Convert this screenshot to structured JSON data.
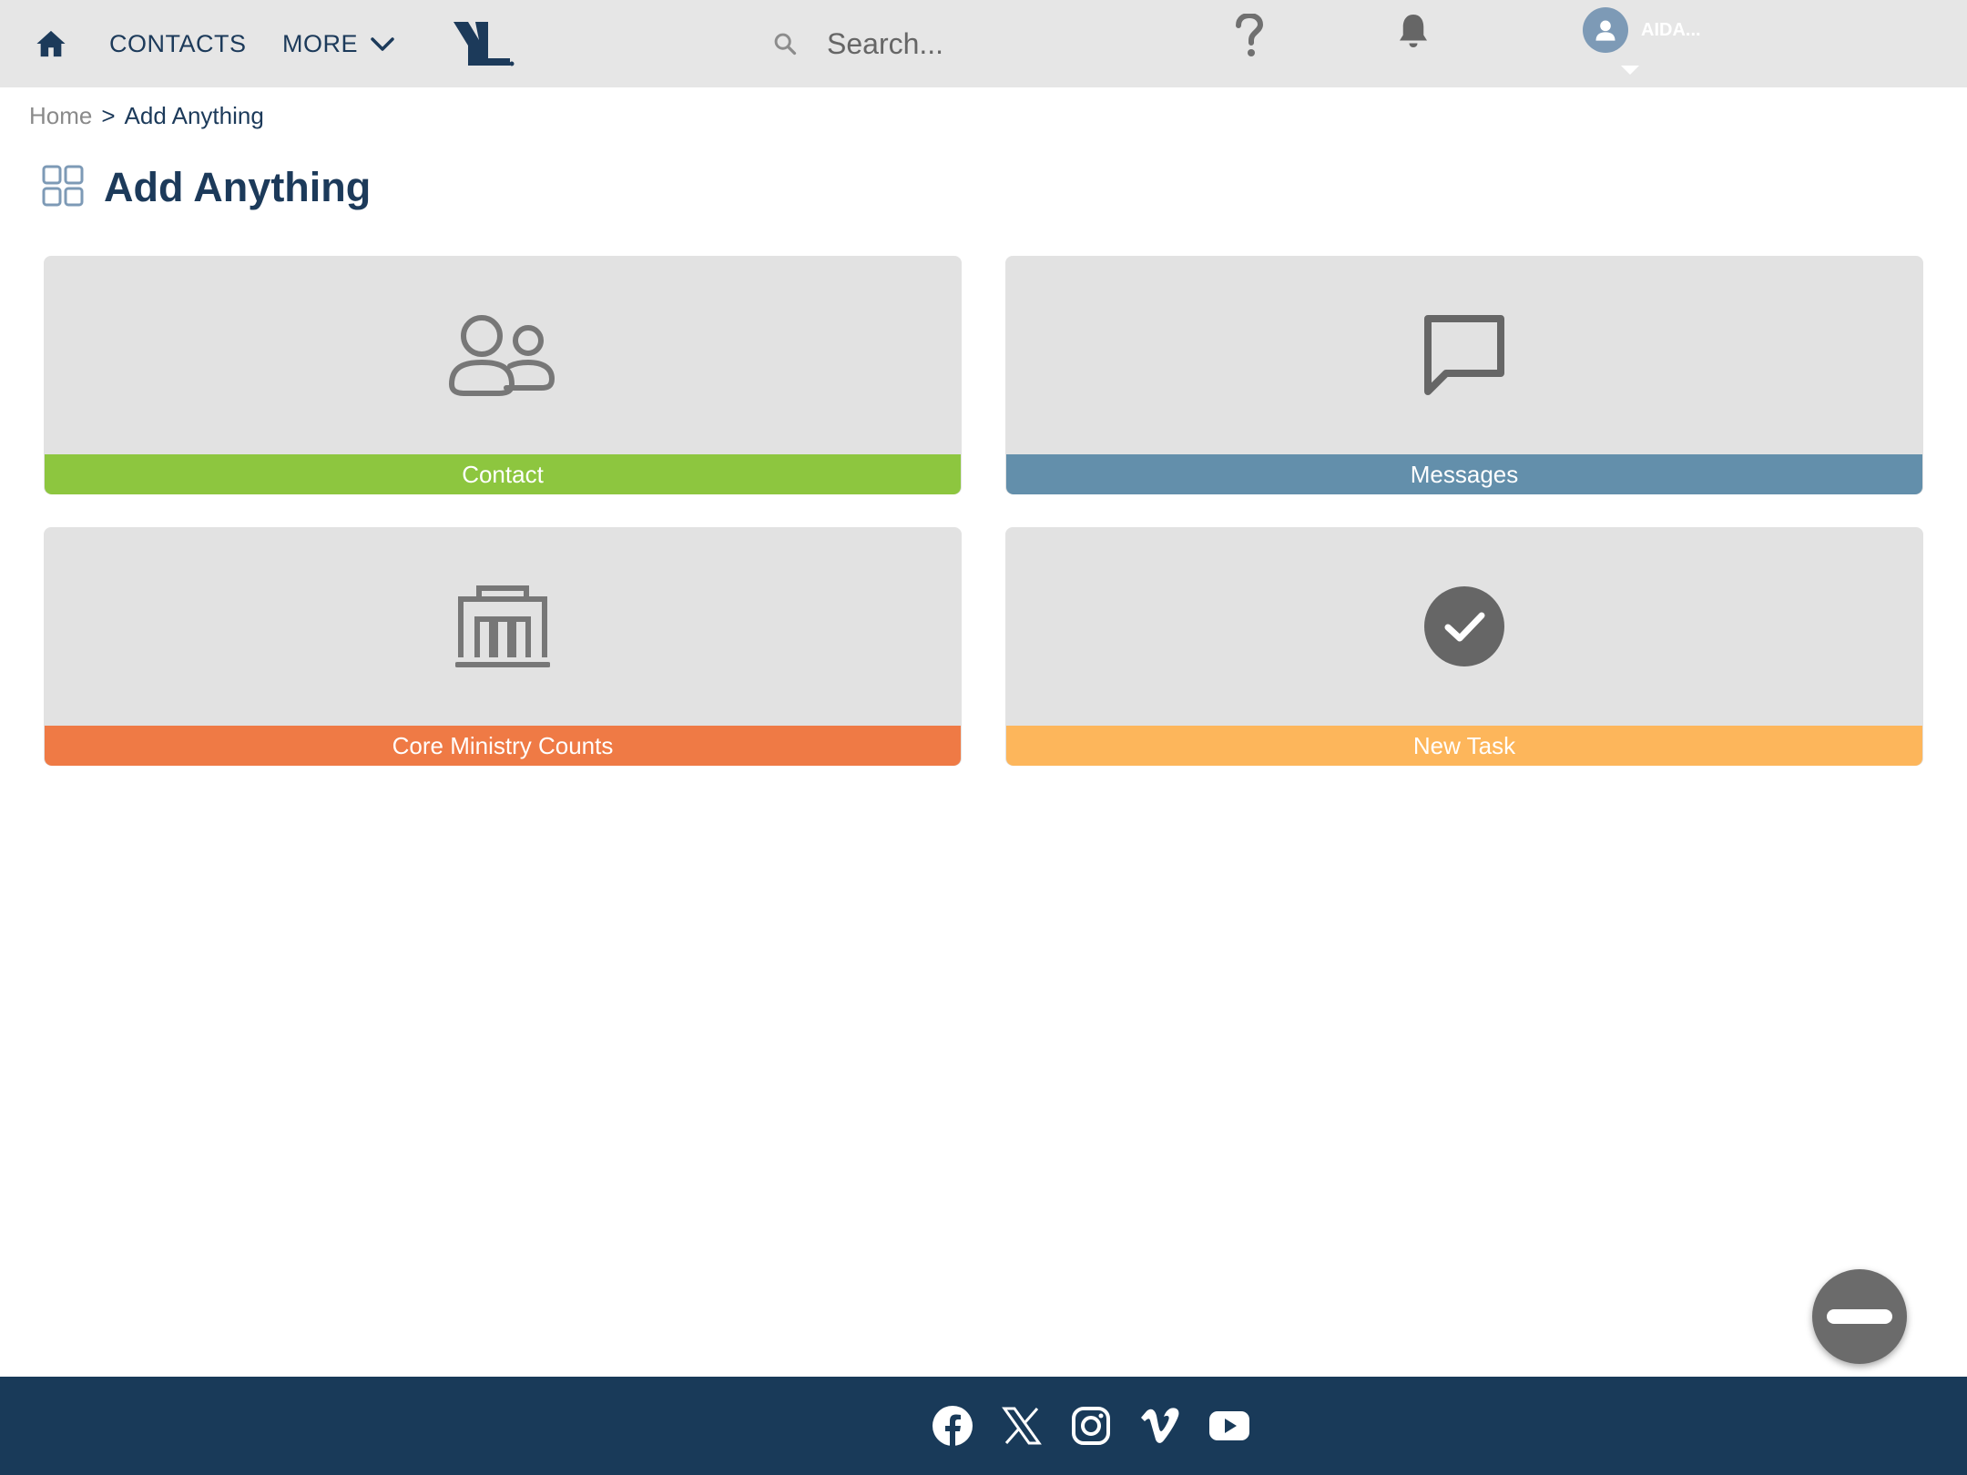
{
  "header": {
    "home_icon": "home-icon",
    "nav": {
      "contacts_label": "CONTACTS",
      "more_label": "MORE"
    },
    "logo_icon": "yl-logo",
    "search": {
      "placeholder": "Search...",
      "value": ""
    },
    "help_icon": "question-mark-icon",
    "notifications_icon": "bell-icon",
    "user": {
      "name": "AIDA...",
      "avatar_icon": "user-avatar-icon"
    }
  },
  "breadcrumb": {
    "home": "Home",
    "separator": ">",
    "current": "Add Anything"
  },
  "page": {
    "title": "Add Anything",
    "title_icon": "grid-icon"
  },
  "cards": [
    {
      "label": "Contact",
      "icon": "people-icon",
      "color": "#8dc63f"
    },
    {
      "label": "Messages",
      "icon": "chat-bubble-icon",
      "color": "#638fab"
    },
    {
      "label": "Core Ministry Counts",
      "icon": "building-columns-icon",
      "color": "#ef7a45"
    },
    {
      "label": "New Task",
      "icon": "check-circle-icon",
      "color": "#fdb65b"
    }
  ],
  "fab": {
    "icon": "minus-icon"
  },
  "footer": {
    "social": [
      "facebook-icon",
      "x-icon",
      "instagram-icon",
      "vimeo-icon",
      "youtube-icon"
    ],
    "background": "#193a59"
  },
  "colors": {
    "topbar": "#e6e6e6",
    "navy": "#1c3a5a",
    "card_bg": "#e2e2e2",
    "icon_gray": "#6b6b6b"
  }
}
